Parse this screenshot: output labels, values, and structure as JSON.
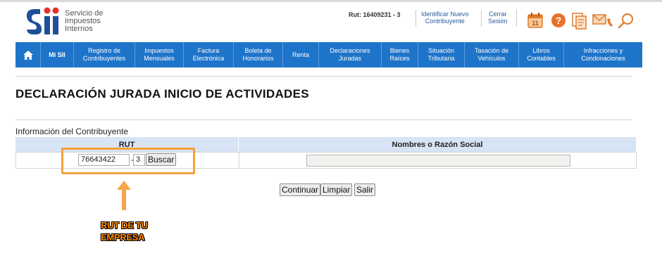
{
  "header": {
    "logo_lines": [
      "Servicio de",
      "Impuestos",
      "Internos"
    ],
    "rut_label": "Rut: 16409231 - 3",
    "identify_link": "Identificar Nuevo\nContribuyente",
    "logout_link": "Cerrar\nSesión",
    "icons": [
      "calendar-icon",
      "help-icon",
      "documents-icon",
      "mail-phone-icon",
      "search-icon"
    ],
    "calendar_day": "11"
  },
  "nav": {
    "items": [
      "Mi SII",
      "Registro de\nContribuyentes",
      "Impuestos\nMensuales",
      "Factura\nElectrónica",
      "Boleta de\nHonorarios",
      "Renta",
      "Declaraciones\nJuradas",
      "Bienes\nRaíces",
      "Situación\nTributaria",
      "Tasación de\nVehículos",
      "Libros\nContables",
      "Infracciones y\nCondonaciones"
    ]
  },
  "page": {
    "title": "DECLARACIÓN JURADA INICIO DE ACTIVIDADES",
    "section": "Información del Contribuyente"
  },
  "form": {
    "col_rut": "RUT",
    "col_name": "Nombres o Razón Social",
    "rut_value": "76643422",
    "dash": "-",
    "dv_value": "3",
    "search_button": "Buscar",
    "name_value": ""
  },
  "actions": {
    "continue": "Continuar",
    "clean": "Limpiar",
    "exit": "Salir"
  },
  "annotation": {
    "line1": "RUT DE TU",
    "line2": "EMPRESA",
    "color": "#f4a13a"
  }
}
